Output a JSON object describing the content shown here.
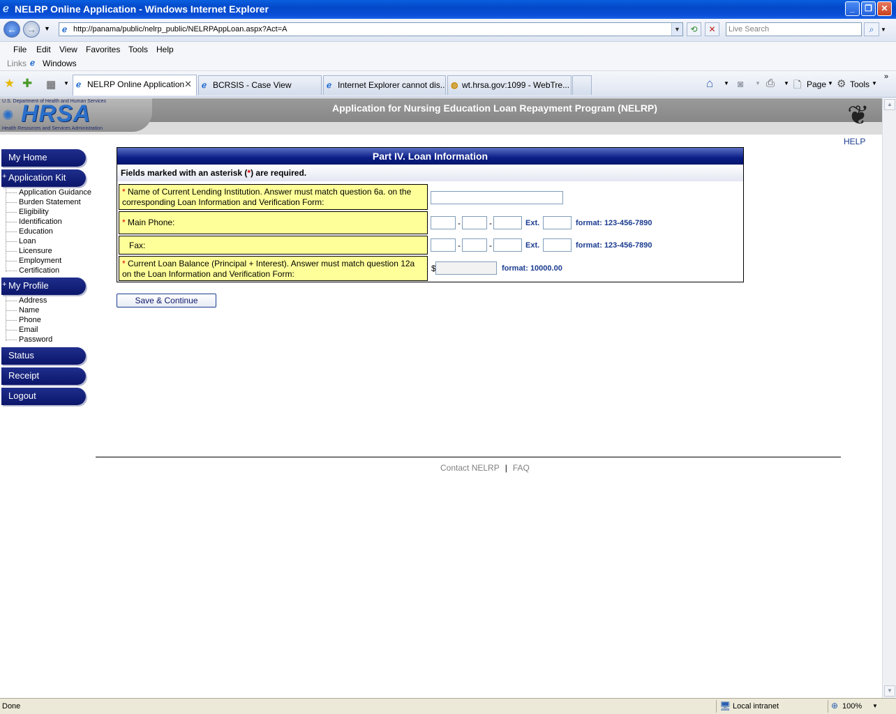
{
  "window": {
    "title": "NELRP Online Application - Windows Internet Explorer"
  },
  "address_bar": {
    "url": "http://panama/public/nelrp_public/NELRPAppLoan.aspx?Act=A",
    "search_placeholder": "Live Search"
  },
  "menu": {
    "items": [
      "File",
      "Edit",
      "View",
      "Favorites",
      "Tools",
      "Help"
    ]
  },
  "links_bar": {
    "label": "Links",
    "item": "Windows"
  },
  "tabs": [
    {
      "label": "NELRP Online Application"
    },
    {
      "label": "BCRSIS - Case View"
    },
    {
      "label": "Internet Explorer cannot dis..."
    },
    {
      "label": "wt.hrsa.gov:1099 - WebTre..."
    }
  ],
  "toolbar_right": {
    "page": "Page",
    "tools": "Tools"
  },
  "banner": {
    "agency_top": "U.S. Department of Health and Human Services",
    "logo": "HRSA",
    "agency_bottom": "Health Resources and Services Administration",
    "title": "Application for Nursing Education Loan Repayment Program (NELRP)",
    "help": "HELP"
  },
  "sidebar": {
    "my_home": "My Home",
    "application_kit": "Application Kit",
    "application_kit_items": [
      "Application Guidance",
      "Burden Statement",
      "Eligibility",
      "Identification",
      "Education",
      "Loan",
      "Licensure",
      "Employment",
      "Certification"
    ],
    "my_profile": "My Profile",
    "my_profile_items": [
      "Address",
      "Name",
      "Phone",
      "Email",
      "Password"
    ],
    "status": "Status",
    "receipt": "Receipt",
    "logout": "Logout"
  },
  "form": {
    "heading": "Part IV. Loan Information",
    "required_note_pre": "Fields marked with an asterisk (",
    "asterisk": "*",
    "required_note_post": ") are required.",
    "lending_label": "Name of Current Lending Institution. Answer must match question 6a. on the corresponding Loan Information and Verification Form:",
    "main_phone_label": "Main Phone:",
    "fax_label": "Fax:",
    "balance_label": "Current Loan Balance (Principal + Interest). Answer must match question 12a on the Loan Information and Verification Form:",
    "dash": "-",
    "ext": "Ext.",
    "phone_format": "format:  123-456-7890",
    "currency": "$",
    "balance_format": "format:  10000.00",
    "save_button": "Save & Continue"
  },
  "footer": {
    "contact": "Contact NELRP",
    "separator": "|",
    "faq": "FAQ"
  },
  "status_bar": {
    "status": "Done",
    "zone": "Local intranet",
    "zoom": "100%"
  }
}
